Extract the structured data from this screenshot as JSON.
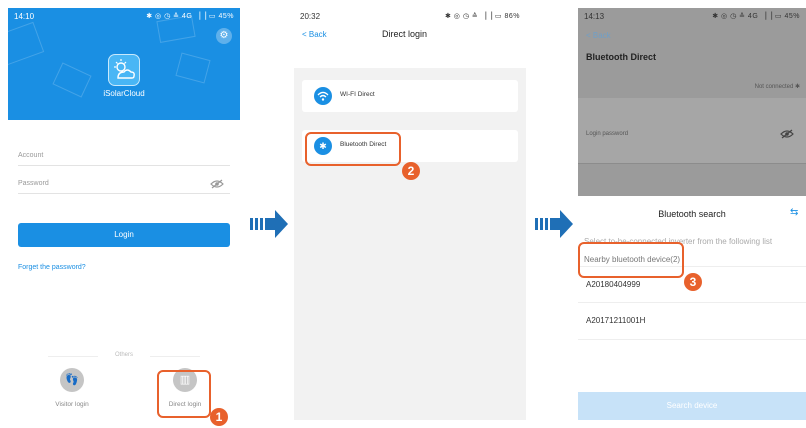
{
  "screen1": {
    "status_time": "14:10",
    "status_right": "✱ ◎ ◷ ≙ 4G ▕▕ ▭ 45%",
    "app_name": "iSolarCloud",
    "account_placeholder": "Account",
    "password_placeholder": "Password",
    "login_label": "Login",
    "forget_label": "Forget the password?",
    "others_label": "Others",
    "visitor_label": "Visitor login",
    "direct_label": "Direct login",
    "step": "1"
  },
  "screen2": {
    "status_time": "20:32",
    "status_right": "✱ ◎ ◷ ≙ ▕▕ ▭ 86%",
    "back_label": "< Back",
    "title": "Direct login",
    "wifi_label": "WI-FI Direct",
    "bt_label": "Bluetooth Direct",
    "step": "2"
  },
  "screen3": {
    "status_time": "14:13",
    "status_right": "✱ ◎ ◷ ≙ 4G ▕▕ ▭ 45%",
    "back_label": "< Back",
    "title": "Bluetooth Direct",
    "not_connected": "Not connected ✱",
    "login_password": "Login password",
    "sheet_title": "Bluetooth search",
    "hint": "Select to-be-connected inverter from the following list",
    "nearby": "Nearby bluetooth device(2)",
    "devices": [
      "A20180404999",
      "A20171211001H"
    ],
    "search_label": "Search device",
    "step": "3"
  },
  "colors": {
    "accent": "#1a8fe3",
    "highlight": "#e8612c",
    "arrow": "#1f6fb6"
  }
}
